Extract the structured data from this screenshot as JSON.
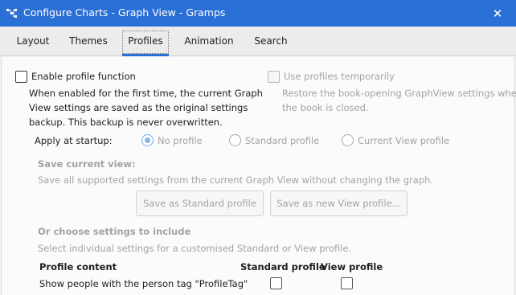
{
  "window": {
    "title": "Configure Charts - Graph View - Gramps",
    "close_glyph": "✕",
    "app_icon": "gramps-app-icon",
    "close_icon": "close-icon"
  },
  "tabs": [
    {
      "label": "Layout"
    },
    {
      "label": "Themes"
    },
    {
      "label": "Profiles"
    },
    {
      "label": "Animation"
    },
    {
      "label": "Search"
    }
  ],
  "active_tab": "Profiles",
  "colors": {
    "accent": "#2a6fd6",
    "disabled_text": "#a3a3a3"
  },
  "profiles": {
    "enable_label": "Enable profile function",
    "enable_checked": false,
    "enable_desc": [
      "When enabled for the first time, the current Graph",
      "View settings are saved as the original settings",
      "backup. This backup is never overwritten."
    ],
    "temp_label": "Use profiles temporarily",
    "temp_checked": false,
    "temp_desc": [
      "Restore the book-opening GraphView settings when",
      "the book is closed."
    ],
    "startup_label": "Apply at startup:",
    "startup_options": [
      {
        "label": "No profile",
        "selected": true
      },
      {
        "label": "Standard profile",
        "selected": false
      },
      {
        "label": "Current View profile",
        "selected": false
      }
    ],
    "save_heading": "Save current view:",
    "save_desc": "Save all supported settings from the current Graph View without changing the graph.",
    "save_standard_button": "Save as Standard profile",
    "save_view_button": "Save as new View profile...",
    "choose_heading": "Or choose settings to include",
    "choose_desc": "Select individual settings for a customised Standard or View profile.",
    "table": {
      "headers": [
        "Profile content",
        "Standard profile",
        "View profile"
      ],
      "rows": [
        {
          "label": "Show people with the person tag \"ProfileTag\"",
          "standard": false,
          "view": false
        }
      ]
    }
  }
}
